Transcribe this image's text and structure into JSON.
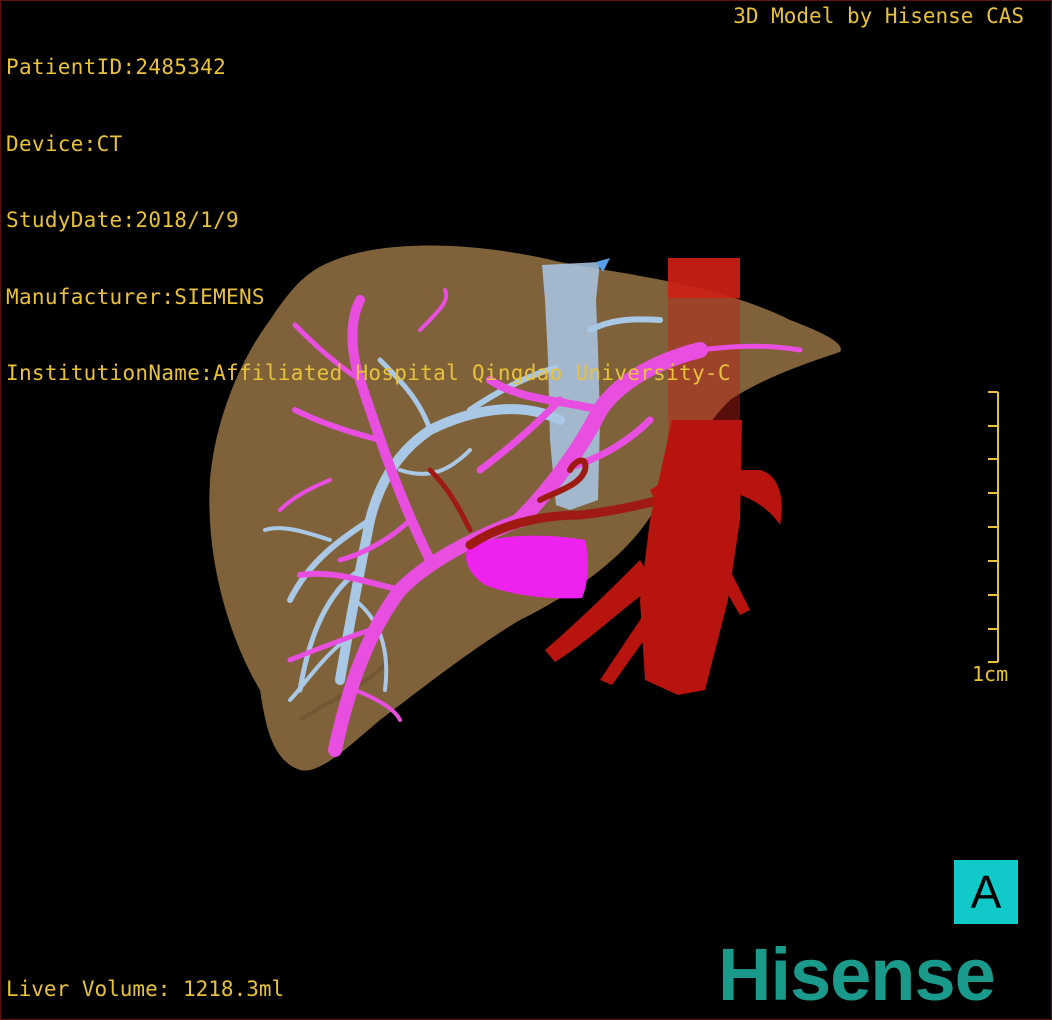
{
  "header": {
    "patient_id": "PatientID:2485342",
    "device": "Device:CT",
    "study_date": "StudyDate:2018/1/9",
    "manufacturer": "Manufacturer:SIEMENS",
    "institution": "InstitutionName:Affiliated Hospital Qingdao University-C"
  },
  "credit": "3D Model by Hisense CAS",
  "scale_bar": {
    "label": "1cm"
  },
  "orientation": {
    "label": "A"
  },
  "liver_volume": "Liver Volume: 1218.3ml",
  "brand": {
    "name": "Hisense"
  },
  "colors": {
    "text": "#e8c23a",
    "liver": "#8a6a3e",
    "portal_vein": "#e84ee0",
    "hepatic_vein": "#a9c8e6",
    "artery": "#b8140f",
    "lesion": "#ee22ee",
    "orientation_bg": "#11c9c9",
    "brand": "#1a9a8a"
  }
}
